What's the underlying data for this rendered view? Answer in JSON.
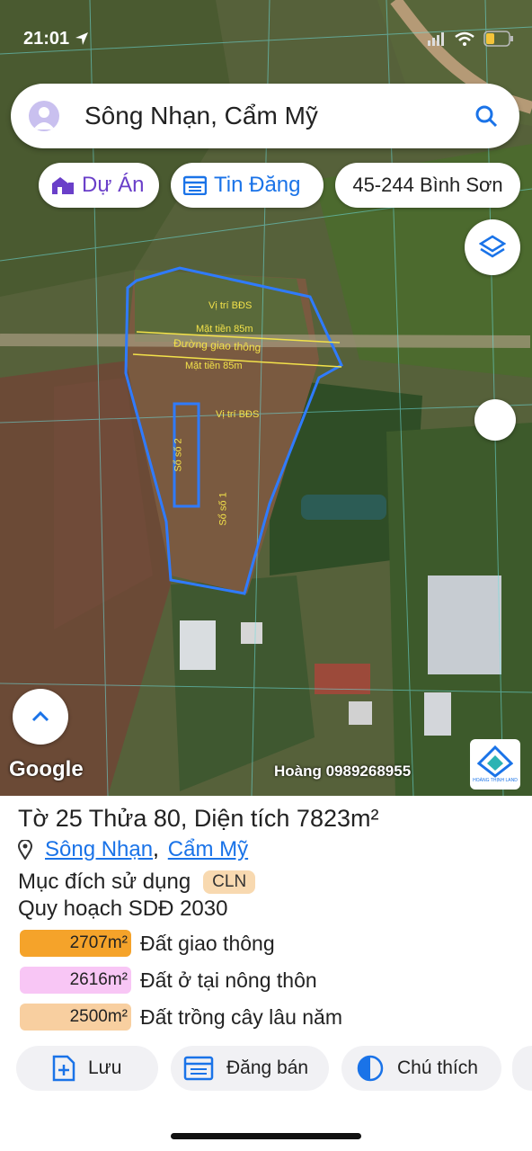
{
  "status_bar": {
    "time": "21:01",
    "battery_level": 0.3
  },
  "search": {
    "title": "Sông Nhạn, Cẩm Mỹ"
  },
  "chips": {
    "du_an": "Dự Án",
    "tin_dang": "Tin Đăng",
    "location": "45-244 Bình Sơn"
  },
  "map_labels": {
    "vi_tri_1": "Vị trí BĐS",
    "mat_tien_1": "Mặt tiền 85m",
    "duong": "Đường giao thông",
    "mat_tien_2": "Mặt tiền 85m",
    "vi_tri_2": "Vị trí BĐS",
    "so_2": "Sổ số 2",
    "so_1": "Sổ số 1"
  },
  "watermark": {
    "google": "Google",
    "agent": "Hoàng 0989268955",
    "logo_text": "HOÀNG THỊNH LAND"
  },
  "parcel": {
    "title": "Tờ 25 Thửa 80, Diện tích 7823m²",
    "place_1": "Sông Nhạn",
    "separator": ",",
    "place_2": "Cẩm Mỹ",
    "purpose_label": "Mục đích sử dụng",
    "purpose_code": "CLN",
    "plan_title": "Quy hoạch SDĐ 2030",
    "legend": [
      {
        "area": "2707m²",
        "label": "Đất giao thông",
        "color": "#f5a32a"
      },
      {
        "area": "2616m²",
        "label": "Đất ở tại nông thôn",
        "color": "#f8c6f5"
      },
      {
        "area": "2500m²",
        "label": "Đất trồng cây lâu năm",
        "color": "#f8cfa0"
      }
    ]
  },
  "actions": {
    "save": "Lưu",
    "sell": "Đăng bán",
    "legend": "Chú thích"
  },
  "colors": {
    "accent": "#6a3fc9",
    "link": "#1a73e8",
    "boundary": "#2f7bff"
  }
}
